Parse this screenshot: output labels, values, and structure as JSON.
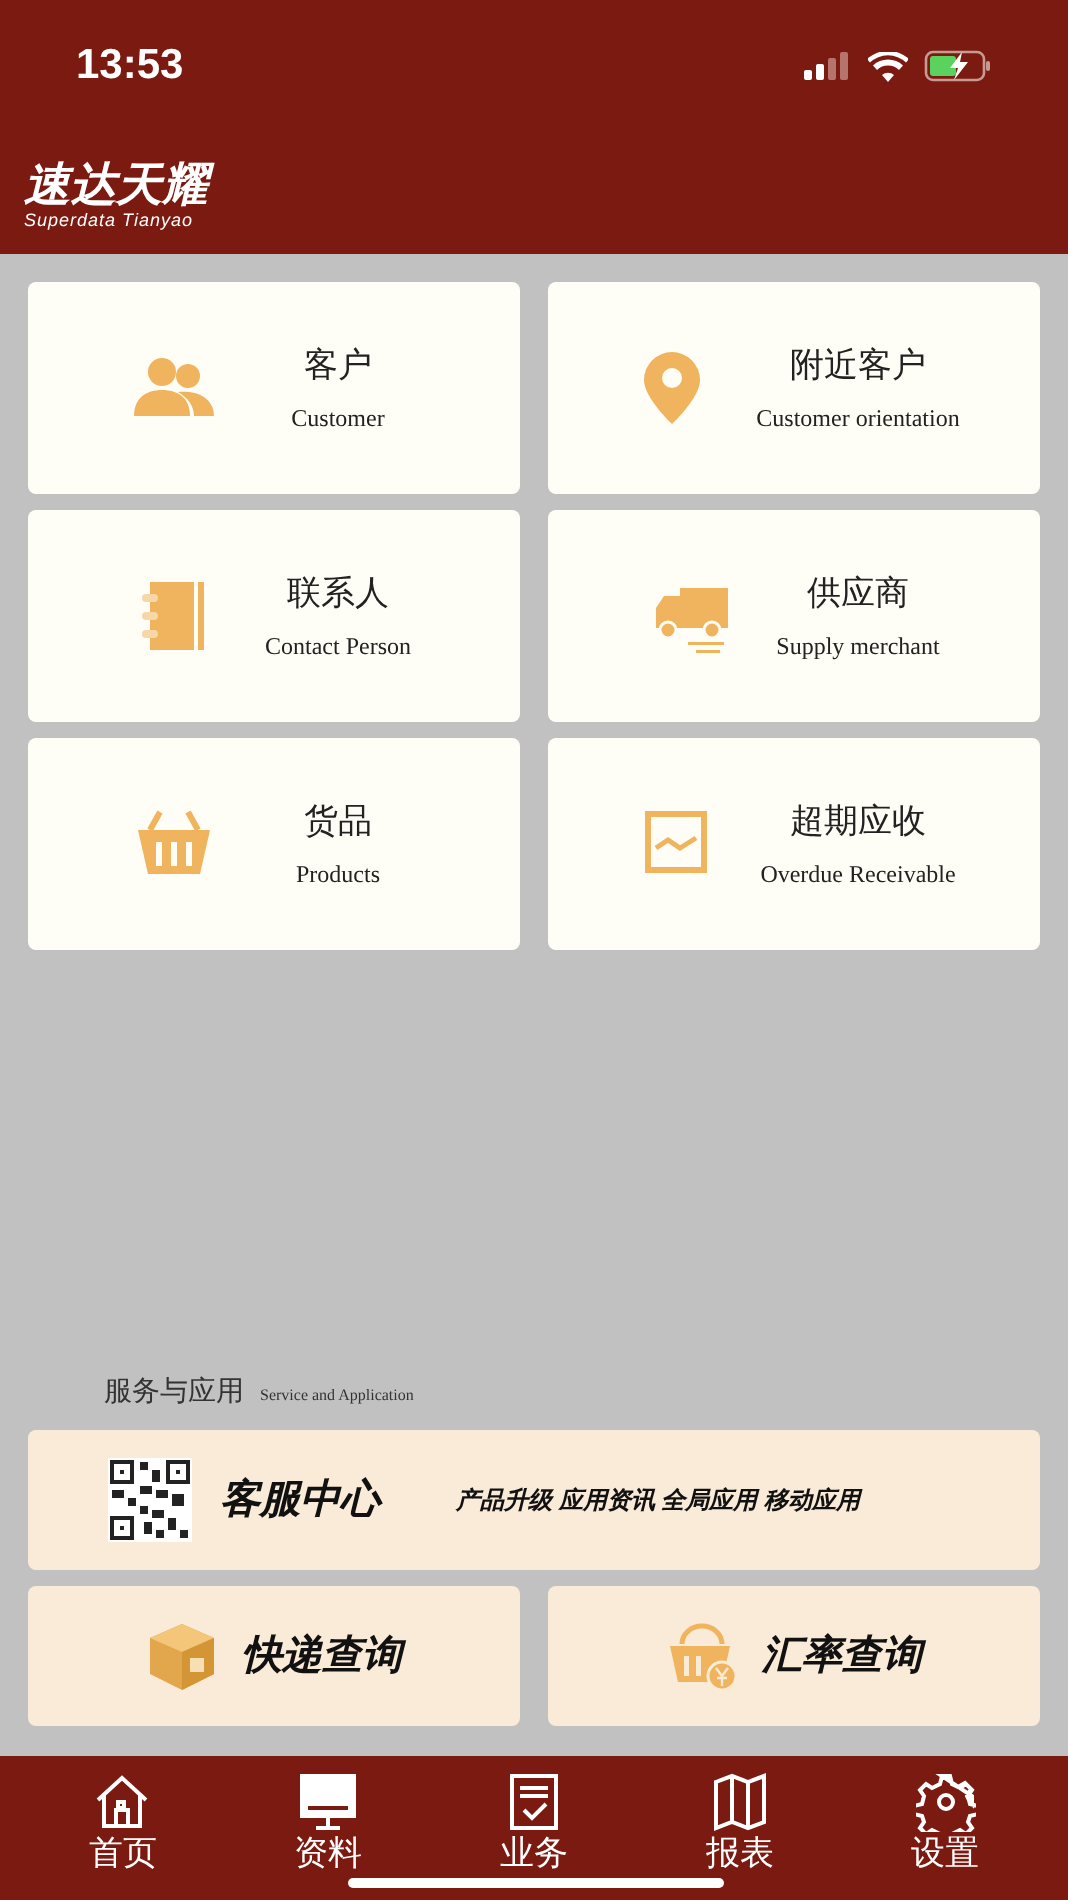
{
  "status_bar": {
    "time": "13:53"
  },
  "header": {
    "logo_title": "速达天耀",
    "logo_subtitle": "Superdata Tianyao"
  },
  "modules": [
    {
      "kind": "people",
      "title": "客户",
      "subtitle": "Customer"
    },
    {
      "kind": "pin",
      "title": "附近客户",
      "subtitle": "Customer orientation"
    },
    {
      "kind": "notebook",
      "title": "联系人",
      "subtitle": "Contact Person"
    },
    {
      "kind": "truck",
      "title": "供应商",
      "subtitle": "Supply merchant"
    },
    {
      "kind": "basket",
      "title": "货品",
      "subtitle": "Products"
    },
    {
      "kind": "chart",
      "title": "超期应收",
      "subtitle": "Overdue Receivable"
    }
  ],
  "services": {
    "heading": "服务与应用",
    "heading_en": "Service and Application",
    "center": {
      "title": "客服中心",
      "description": "产品升级 应用资讯 全局应用 移动应用"
    },
    "items": [
      {
        "kind": "box",
        "title": "快递查询"
      },
      {
        "kind": "rate",
        "title": "汇率查询"
      }
    ]
  },
  "tab_bar": [
    {
      "kind": "home",
      "label": "首页"
    },
    {
      "kind": "monitor",
      "label": "资料"
    },
    {
      "kind": "task",
      "label": "业务"
    },
    {
      "kind": "map",
      "label": "报表"
    },
    {
      "kind": "gear",
      "label": "设置"
    }
  ]
}
